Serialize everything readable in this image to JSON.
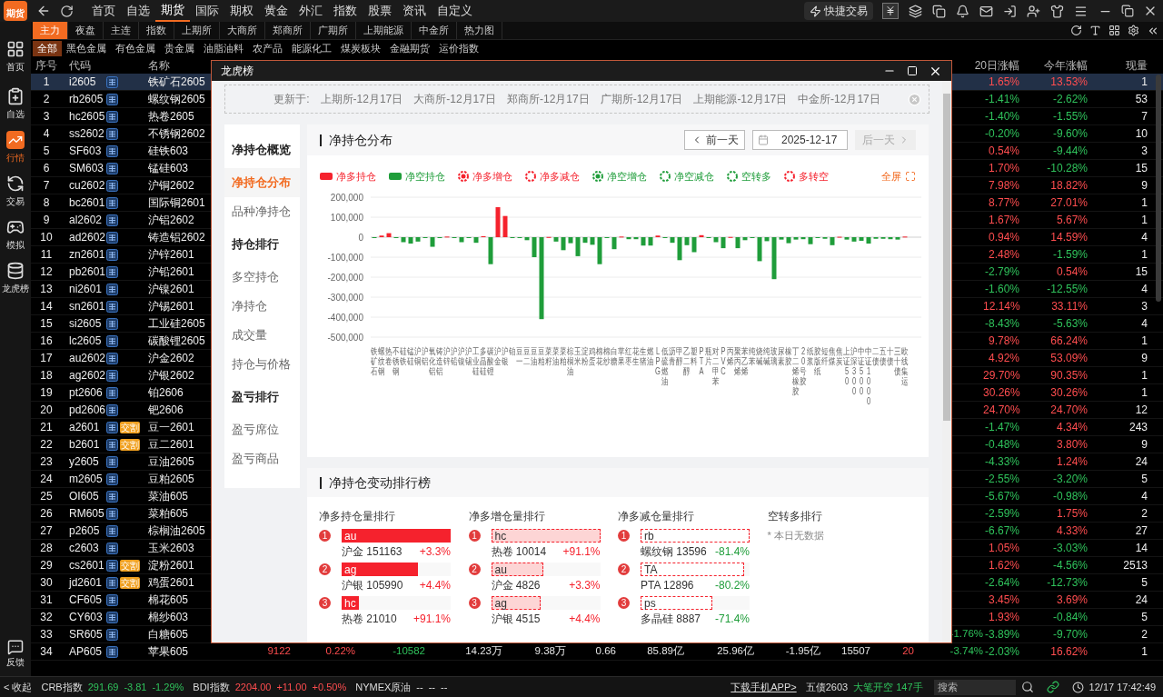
{
  "logo": "期货",
  "menu": [
    {
      "label": "首页",
      "selected": false
    },
    {
      "label": "自选",
      "selected": false
    },
    {
      "label": "期货",
      "selected": true
    },
    {
      "label": "国际",
      "selected": false
    },
    {
      "label": "期权",
      "selected": false
    },
    {
      "label": "黄金",
      "selected": false
    },
    {
      "label": "外汇",
      "selected": false
    },
    {
      "label": "指数",
      "selected": false
    },
    {
      "label": "股票",
      "selected": false
    },
    {
      "label": "资讯",
      "selected": false
    },
    {
      "label": "自定义",
      "selected": false
    }
  ],
  "quick_trade": "快捷交易",
  "sidebar": [
    {
      "label": "首页",
      "kind": "home",
      "selected": false
    },
    {
      "label": "自选",
      "kind": "watch",
      "selected": false
    },
    {
      "label": "行情",
      "kind": "market",
      "selected": true
    },
    {
      "label": "交易",
      "kind": "trade",
      "selected": false
    },
    {
      "label": "模拟",
      "kind": "sim",
      "selected": false
    },
    {
      "label": "龙虎榜",
      "kind": "rank",
      "selected": false
    }
  ],
  "feedback": "反馈",
  "market_tabs": [
    {
      "label": "主力",
      "selected": true
    },
    {
      "label": "夜盘",
      "selected": false
    },
    {
      "label": "主连",
      "selected": false
    },
    {
      "label": "指数",
      "selected": false
    },
    {
      "label": "上期所",
      "selected": false
    },
    {
      "label": "大商所",
      "selected": false
    },
    {
      "label": "郑商所",
      "selected": false
    },
    {
      "label": "广期所",
      "selected": false
    },
    {
      "label": "上期能源",
      "selected": false
    },
    {
      "label": "中金所",
      "selected": false
    },
    {
      "label": "热力图",
      "selected": false
    }
  ],
  "sector_tabs": [
    {
      "label": "全部",
      "selected": true
    },
    {
      "label": "黑色金属",
      "selected": false
    },
    {
      "label": "有色金属",
      "selected": false
    },
    {
      "label": "贵金属",
      "selected": false
    },
    {
      "label": "油脂油料",
      "selected": false
    },
    {
      "label": "农产品",
      "selected": false
    },
    {
      "label": "能源化工",
      "selected": false
    },
    {
      "label": "煤炭板块",
      "selected": false
    },
    {
      "label": "金融期货",
      "selected": false
    },
    {
      "label": "运价指数",
      "selected": false
    }
  ],
  "table": {
    "columns": [
      "序号",
      "代码",
      "名称",
      "20日涨幅",
      "今年涨幅",
      "现量"
    ],
    "rows": [
      {
        "no": "1",
        "code": "i2605",
        "name": "铁矿石2605",
        "pct20": {
          "text": "1.65%",
          "kind": "up"
        },
        "ytd": {
          "text": "13.53%",
          "kind": "up"
        },
        "vol": "1",
        "selected": true
      },
      {
        "no": "2",
        "code": "rb2605",
        "name": "螺纹钢2605",
        "pct20": {
          "text": "-1.41%",
          "kind": "down"
        },
        "ytd": {
          "text": "-2.62%",
          "kind": "down"
        },
        "vol": "53",
        "selected": false
      },
      {
        "no": "3",
        "code": "hc2605",
        "name": "热卷2605",
        "pct20": {
          "text": "-1.40%",
          "kind": "down"
        },
        "ytd": {
          "text": "-1.55%",
          "kind": "down"
        },
        "vol": "7",
        "selected": false
      },
      {
        "no": "4",
        "code": "ss2602",
        "name": "不锈钢2602",
        "pct20": {
          "text": "-0.20%",
          "kind": "down"
        },
        "ytd": {
          "text": "-9.60%",
          "kind": "down"
        },
        "vol": "10",
        "selected": false
      },
      {
        "no": "5",
        "code": "SF603",
        "name": "硅铁603",
        "pct20": {
          "text": "0.54%",
          "kind": "up"
        },
        "ytd": {
          "text": "-9.44%",
          "kind": "down"
        },
        "vol": "3",
        "selected": false
      },
      {
        "no": "6",
        "code": "SM603",
        "name": "锰硅603",
        "pct20": {
          "text": "1.70%",
          "kind": "up"
        },
        "ytd": {
          "text": "-10.28%",
          "kind": "down"
        },
        "vol": "15",
        "selected": false
      },
      {
        "no": "7",
        "code": "cu2602",
        "name": "沪铜2602",
        "pct20": {
          "text": "7.98%",
          "kind": "up"
        },
        "ytd": {
          "text": "18.82%",
          "kind": "up"
        },
        "vol": "9",
        "selected": false
      },
      {
        "no": "8",
        "code": "bc2601",
        "name": "国际铜2601",
        "pct20": {
          "text": "8.77%",
          "kind": "up"
        },
        "ytd": {
          "text": "27.01%",
          "kind": "up"
        },
        "vol": "1",
        "selected": false
      },
      {
        "no": "9",
        "code": "al2602",
        "name": "沪铝2602",
        "pct20": {
          "text": "1.67%",
          "kind": "up"
        },
        "ytd": {
          "text": "5.67%",
          "kind": "up"
        },
        "vol": "1",
        "selected": false
      },
      {
        "no": "10",
        "code": "ad2602",
        "name": "铸造铝2602",
        "pct20": {
          "text": "0.94%",
          "kind": "up"
        },
        "ytd": {
          "text": "14.59%",
          "kind": "up"
        },
        "vol": "4",
        "selected": false
      },
      {
        "no": "11",
        "code": "zn2601",
        "name": "沪锌2601",
        "pct20": {
          "text": "2.48%",
          "kind": "up"
        },
        "ytd": {
          "text": "-1.59%",
          "kind": "down"
        },
        "vol": "1",
        "selected": false
      },
      {
        "no": "12",
        "code": "pb2601",
        "name": "沪铅2601",
        "pct20": {
          "text": "-2.79%",
          "kind": "down"
        },
        "ytd": {
          "text": "0.54%",
          "kind": "up"
        },
        "vol": "15",
        "selected": false
      },
      {
        "no": "13",
        "code": "ni2601",
        "name": "沪镍2601",
        "pct20": {
          "text": "-1.60%",
          "kind": "down"
        },
        "ytd": {
          "text": "-12.55%",
          "kind": "down"
        },
        "vol": "4",
        "selected": false
      },
      {
        "no": "14",
        "code": "sn2601",
        "name": "沪锡2601",
        "pct20": {
          "text": "12.14%",
          "kind": "up"
        },
        "ytd": {
          "text": "33.11%",
          "kind": "up"
        },
        "vol": "3",
        "selected": false
      },
      {
        "no": "15",
        "code": "si2605",
        "name": "工业硅2605",
        "pct20": {
          "text": "-8.43%",
          "kind": "down"
        },
        "ytd": {
          "text": "-5.63%",
          "kind": "down"
        },
        "vol": "4",
        "selected": false
      },
      {
        "no": "16",
        "code": "lc2605",
        "name": "碳酸锂2605",
        "pct20": {
          "text": "9.78%",
          "kind": "up"
        },
        "ytd": {
          "text": "66.24%",
          "kind": "up"
        },
        "vol": "1",
        "selected": false
      },
      {
        "no": "17",
        "code": "au2602",
        "name": "沪金2602",
        "pct20": {
          "text": "4.92%",
          "kind": "up"
        },
        "ytd": {
          "text": "53.09%",
          "kind": "up"
        },
        "vol": "9",
        "selected": false
      },
      {
        "no": "18",
        "code": "ag2602",
        "name": "沪银2602",
        "pct20": {
          "text": "29.70%",
          "kind": "up"
        },
        "ytd": {
          "text": "90.35%",
          "kind": "up"
        },
        "vol": "1",
        "selected": false
      },
      {
        "no": "19",
        "code": "pt2606",
        "name": "铂2606",
        "pct20": {
          "text": "30.26%",
          "kind": "up"
        },
        "ytd": {
          "text": "30.26%",
          "kind": "up"
        },
        "vol": "1",
        "selected": false
      },
      {
        "no": "20",
        "code": "pd2606",
        "name": "钯2606",
        "pct20": {
          "text": "24.70%",
          "kind": "up"
        },
        "ytd": {
          "text": "24.70%",
          "kind": "up"
        },
        "vol": "12",
        "selected": false
      },
      {
        "no": "21",
        "code": "a2601",
        "badge": "交割",
        "name": "豆一2601",
        "pct20": {
          "text": "-1.47%",
          "kind": "down"
        },
        "ytd": {
          "text": "4.34%",
          "kind": "up"
        },
        "vol": "243",
        "selected": false
      },
      {
        "no": "22",
        "code": "b2601",
        "badge": "交割",
        "name": "豆二2601",
        "pct20": {
          "text": "-0.48%",
          "kind": "down"
        },
        "ytd": {
          "text": "3.80%",
          "kind": "up"
        },
        "vol": "9",
        "selected": false
      },
      {
        "no": "23",
        "code": "y2605",
        "name": "豆油2605",
        "pct20": {
          "text": "-4.33%",
          "kind": "down"
        },
        "ytd": {
          "text": "1.24%",
          "kind": "up"
        },
        "vol": "24",
        "selected": false
      },
      {
        "no": "24",
        "code": "m2605",
        "name": "豆粕2605",
        "pct20": {
          "text": "-2.55%",
          "kind": "down"
        },
        "ytd": {
          "text": "-3.20%",
          "kind": "down"
        },
        "vol": "5",
        "selected": false
      },
      {
        "no": "25",
        "code": "OI605",
        "name": "菜油605",
        "pct20": {
          "text": "-5.67%",
          "kind": "down"
        },
        "ytd": {
          "text": "-0.98%",
          "kind": "down"
        },
        "vol": "4",
        "selected": false
      },
      {
        "no": "26",
        "code": "RM605",
        "name": "菜粕605",
        "pct20": {
          "text": "-2.59%",
          "kind": "down"
        },
        "ytd": {
          "text": "1.75%",
          "kind": "up"
        },
        "vol": "2",
        "selected": false
      },
      {
        "no": "27",
        "code": "p2605",
        "name": "棕榈油2605",
        "pct20": {
          "text": "-6.67%",
          "kind": "down"
        },
        "ytd": {
          "text": "4.33%",
          "kind": "up"
        },
        "vol": "27",
        "selected": false
      },
      {
        "no": "28",
        "code": "c2603",
        "name": "玉米2603",
        "pct20": {
          "text": "1.05%",
          "kind": "up"
        },
        "ytd": {
          "text": "-3.03%",
          "kind": "down"
        },
        "vol": "14",
        "selected": false
      },
      {
        "no": "29",
        "code": "cs2601",
        "badge": "交割",
        "name": "淀粉2601",
        "pct20": {
          "text": "1.62%",
          "kind": "up"
        },
        "ytd": {
          "text": "-4.56%",
          "kind": "down"
        },
        "vol": "2513",
        "selected": false
      },
      {
        "no": "30",
        "code": "jd2601",
        "badge": "交割",
        "name": "鸡蛋2601",
        "pct20": {
          "text": "-2.64%",
          "kind": "down"
        },
        "ytd": {
          "text": "-12.73%",
          "kind": "down"
        },
        "vol": "5",
        "selected": false
      },
      {
        "no": "31",
        "code": "CF605",
        "name": "棉花605",
        "pct20": {
          "text": "3.45%",
          "kind": "up"
        },
        "ytd": {
          "text": "3.69%",
          "kind": "up"
        },
        "vol": "24",
        "selected": false
      },
      {
        "no": "32",
        "code": "CY603",
        "name": "棉纱603",
        "pct20": {
          "text": "1.93%",
          "kind": "up"
        },
        "ytd": {
          "text": "-0.84%",
          "kind": "down"
        },
        "vol": "5",
        "selected": false
      },
      {
        "no": "33",
        "code": "SR605",
        "name": "白糖605",
        "mid": [
          {
            "text": "-1.76%",
            "kind": "down"
          }
        ],
        "pct20": {
          "text": "-3.89%",
          "kind": "down"
        },
        "ytd": {
          "text": "-9.70%",
          "kind": "down"
        },
        "vol": "2",
        "selected": false
      },
      {
        "no": "34",
        "code": "AP605",
        "name": "苹果605",
        "mid": [
          {
            "text": "9122",
            "kind": "up"
          },
          {
            "text": "0.22%",
            "kind": "up"
          },
          {
            "text": "-10582",
            "kind": "down"
          },
          {
            "text": "14.23万",
            "kind": "flat"
          },
          {
            "text": "9.38万",
            "kind": "flat"
          },
          {
            "text": "0.66",
            "kind": "flat"
          },
          {
            "text": "85.89亿",
            "kind": "flat"
          },
          {
            "text": "25.96亿",
            "kind": "flat"
          },
          {
            "text": "-1.95亿",
            "kind": "flat"
          },
          {
            "text": "15507",
            "kind": "flat"
          },
          {
            "text": "20",
            "kind": "up"
          },
          {
            "text": "-3.74%",
            "kind": "down"
          }
        ],
        "pct20": {
          "text": "-2.03%",
          "kind": "down"
        },
        "ytd": {
          "text": "16.62%",
          "kind": "up"
        },
        "vol": "1",
        "selected": false
      }
    ]
  },
  "dialog": {
    "title": "龙虎榜",
    "update": {
      "label": "更新于:",
      "items": [
        "上期所-12月17日",
        "大商所-12月17日",
        "郑商所-12月17日",
        "广期所-12月17日",
        "上期能源-12月17日",
        "中金所-12月17日"
      ]
    },
    "nav": [
      {
        "label": "净持仓概览",
        "kind": "header"
      },
      {
        "label": "净持仓分布",
        "kind": "item",
        "selected": true
      },
      {
        "label": "品种净持仓",
        "kind": "item",
        "selected": false
      },
      {
        "label": "持仓排行",
        "kind": "header"
      },
      {
        "label": "多空持仓",
        "kind": "item",
        "selected": false
      },
      {
        "label": "净持仓",
        "kind": "item",
        "selected": false
      },
      {
        "label": "成交量",
        "kind": "item",
        "selected": false
      },
      {
        "label": "持仓与价格",
        "kind": "item",
        "selected": false
      },
      {
        "label": "盈亏排行",
        "kind": "header"
      },
      {
        "label": "盈亏席位",
        "kind": "item",
        "selected": false
      },
      {
        "label": "盈亏商品",
        "kind": "item",
        "selected": false
      }
    ],
    "chart_card": {
      "title": "净持仓分布",
      "prev": "前一天",
      "date": "2025-12-17",
      "next": "后一天",
      "next_disabled": true,
      "fullscreen": "全屏",
      "legend": [
        {
          "label": "净多增仓",
          "color": "#f5222d",
          "kind": "filled_ring"
        },
        {
          "label": "净多减仓",
          "color": "#f5222d",
          "kind": "ring"
        },
        {
          "label": "净空增仓",
          "color": "#1f9d3a",
          "kind": "filled_ring"
        },
        {
          "label": "净空减仓",
          "color": "#1f9d3a",
          "kind": "ring"
        },
        {
          "label": "空转多",
          "color": "#1f9d3a",
          "kind": "ring"
        },
        {
          "label": "多转空",
          "color": "#f5222d",
          "kind": "ring"
        }
      ],
      "chart_data": {
        "type": "bar",
        "stacked": true,
        "grid": true,
        "categories": [
          "铁矿石",
          "螺纹钢",
          "热卷",
          "不锈钢",
          "硅铁",
          "锰硅",
          "沪铜",
          "沪铝",
          "氧化铝",
          "铸造铝",
          "沪锌",
          "沪铅",
          "沪镍",
          "沪锡",
          "工业硅",
          "多晶硅",
          "碳酸锂",
          "沪金",
          "沪银",
          "铂",
          "豆一",
          "豆二",
          "豆油",
          "豆粕",
          "菜籽",
          "菜油",
          "菜粕",
          "棕榈油",
          "玉米",
          "淀粉",
          "鸡蛋",
          "棉花",
          "棉纱",
          "白糖",
          "苹果",
          "红枣",
          "花生",
          "生猪",
          "燃油",
          "LPG",
          "低硫燃油",
          "沥青",
          "甲醇",
          "乙二醇",
          "塑料",
          "PTA",
          "瓶片",
          "对二甲苯",
          "PVC",
          "丙烯",
          "聚丙烯",
          "苯乙烯",
          "纯苯",
          "烧碱",
          "纯碱",
          "玻璃",
          "尿素",
          "橡胶",
          "丁二烯橡胶",
          "20号胶",
          "纸浆",
          "胶版纸",
          "短纤",
          "焦煤",
          "焦炭",
          "上证50",
          "沪深300",
          "中证500",
          "中证1000",
          "二债",
          "五债",
          "十债",
          "三十债",
          "欧线集运"
        ],
        "series": [
          {
            "name": "净多持仓",
            "color": "#f5222d",
            "values": [
              null,
              8000,
              20000,
              null,
              null,
              null,
              null,
              null,
              null,
              null,
              3000,
              null,
              null,
              null,
              null,
              5000,
              null,
              150000,
              106000,
              null,
              null,
              null,
              null,
              null,
              1000,
              null,
              null,
              null,
              null,
              null,
              null,
              null,
              null,
              null,
              3000,
              null,
              null,
              null,
              null,
              8000,
              null,
              null,
              null,
              null,
              null,
              10000,
              null,
              null,
              null,
              1000,
              null,
              null,
              null,
              null,
              null,
              null,
              null,
              null,
              null,
              null,
              null,
              null,
              null,
              null,
              2000,
              null,
              null,
              null,
              null,
              null,
              null,
              null,
              null,
              3000
            ]
          },
          {
            "name": "净空持仓",
            "color": "#1f9d3a",
            "values": [
              -3000,
              null,
              null,
              -1000,
              -25000,
              -32000,
              -22000,
              -1000,
              -48000,
              -1000,
              null,
              -2000,
              -25000,
              -1000,
              -28000,
              null,
              -135000,
              null,
              null,
              -3000,
              -3000,
              -15000,
              -100000,
              -410000,
              null,
              -22000,
              -65000,
              -30000,
              -95000,
              -28000,
              -38000,
              -135000,
              -1000,
              -60000,
              null,
              -10000,
              -10000,
              -42000,
              -42000,
              null,
              -3000,
              -28000,
              -115000,
              -40000,
              -75000,
              null,
              -2000,
              -25000,
              -55000,
              null,
              -55000,
              -15000,
              -1000,
              -120000,
              -20000,
              -210000,
              -12000,
              -30000,
              -12000,
              -10000,
              -35000,
              -1000,
              -8000,
              -40000,
              null,
              -12000,
              -22000,
              -18000,
              -32000,
              -8000,
              -8000,
              -10000,
              -12000,
              null
            ]
          }
        ],
        "ylim": [
          -500000,
          200000
        ],
        "yticks": [
          {
            "value": 200000,
            "label": "200,000"
          },
          {
            "value": 100000,
            "label": "100,000"
          },
          {
            "value": 0,
            "label": "0"
          },
          {
            "value": -100000,
            "label": "-100,000"
          },
          {
            "value": -200000,
            "label": "-200,000"
          },
          {
            "value": -300000,
            "label": "-300,000"
          },
          {
            "value": -400000,
            "label": "-400,000"
          },
          {
            "value": -500000,
            "label": "-500,000"
          }
        ]
      }
    },
    "ranking": {
      "title": "净持仓变动排行榜",
      "columns": [
        {
          "title": "净多持仓量排行",
          "kind": "solid",
          "items": [
            {
              "rank": "1",
              "code": "au",
              "name": "沪金 151163",
              "change": {
                "text": "+3.3%",
                "kind": "up"
              },
              "level": 1
            },
            {
              "rank": "2",
              "code": "ag",
              "name": "沪银 105990",
              "change": {
                "text": "+4.4%",
                "kind": "up"
              },
              "level": 0.7
            },
            {
              "rank": "3",
              "code": "hc",
              "name": "热卷 21010",
              "change": {
                "text": "+91.1%",
                "kind": "up"
              },
              "level": 0.16
            }
          ]
        },
        {
          "title": "净多增仓量排行",
          "kind": "tinted",
          "items": [
            {
              "rank": "1",
              "code": "hc",
              "name": "热卷 10014",
              "change": {
                "text": "+91.1%",
                "kind": "up"
              },
              "level": 1
            },
            {
              "rank": "2",
              "code": "au",
              "name": "沪金 4826",
              "change": {
                "text": "+3.3%",
                "kind": "up"
              },
              "level": 0.48
            },
            {
              "rank": "3",
              "code": "ag",
              "name": "沪银 4515",
              "change": {
                "text": "+4.4%",
                "kind": "up"
              },
              "level": 0.45
            }
          ]
        },
        {
          "title": "净多减仓量排行",
          "kind": "outlined",
          "items": [
            {
              "rank": "1",
              "code": "rb",
              "name": "螺纹钢 13596",
              "change": {
                "text": "-81.4%",
                "kind": "down"
              },
              "level": 1
            },
            {
              "rank": "2",
              "code": "TA",
              "name": "PTA 12896",
              "change": {
                "text": "-80.2%",
                "kind": "down"
              },
              "level": 0.95
            },
            {
              "rank": "3",
              "code": "ps",
              "name": "多晶硅 8887",
              "change": {
                "text": "-71.4%",
                "kind": "down"
              },
              "level": 0.66
            }
          ]
        },
        {
          "title": "空转多排行",
          "empty": "* 本日无数据"
        }
      ]
    }
  },
  "status": {
    "collapse": "< 收起",
    "indices": [
      {
        "name": "CRB指数",
        "value": "291.69",
        "change": "-3.81",
        "pct": "-1.29%",
        "kind": "down"
      },
      {
        "name": "BDI指数",
        "value": "2204.00",
        "change": "+11.00",
        "pct": "+0.50%",
        "kind": "up"
      },
      {
        "name": "NYMEX原油",
        "value": "--",
        "change": "--",
        "pct": "--",
        "kind": "flat"
      }
    ],
    "app_link": "下载手机APP>",
    "ticker_code": "五债2603",
    "ticker": {
      "text": "大笔开空 147手",
      "kind": "down"
    },
    "search_placeholder": "搜索",
    "time": "12/17 17:42:49"
  }
}
